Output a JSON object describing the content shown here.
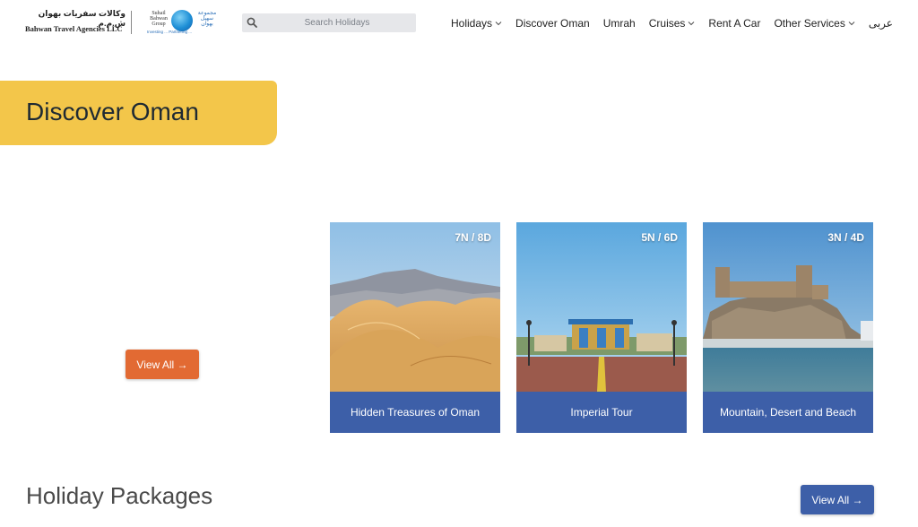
{
  "header": {
    "logo_arabic": "وكالات سفريات بهوان ش.م.م",
    "logo_english": "Bahwan Travel Agencies LLC",
    "group_logo_text_left": "Suhail Bahwan Group",
    "group_logo_text_right": "مجموعة سهيل بهوان",
    "group_logo_tagline": "Investing ... Partnering ...",
    "search_placeholder": "Search Holidays",
    "nav": [
      {
        "label": "Holidays",
        "dropdown": true
      },
      {
        "label": "Discover Oman",
        "dropdown": false
      },
      {
        "label": "Umrah",
        "dropdown": false
      },
      {
        "label": "Cruises",
        "dropdown": true
      },
      {
        "label": "Rent A Car",
        "dropdown": false
      },
      {
        "label": "Other Services",
        "dropdown": true
      },
      {
        "label": "عربى",
        "dropdown": false
      }
    ]
  },
  "banner": {
    "title": "Discover Oman",
    "color": "#f3c64a"
  },
  "discover": {
    "view_all_label": "View All →",
    "view_all_color": "#e26a33",
    "cards": [
      {
        "duration": "7N / 8D",
        "title": "Hidden Treasures of Oman",
        "image": "desert-dunes"
      },
      {
        "duration": "5N / 6D",
        "title": "Imperial Tour",
        "image": "royal-palace"
      },
      {
        "duration": "3N / 4D",
        "title": "Mountain, Desert and Beach",
        "image": "hilltop-fort"
      }
    ],
    "caption_color": "#3d5fa8"
  },
  "packages": {
    "title": "Holiday Packages",
    "view_all_label": "View All →",
    "view_all_color": "#3d5fa8"
  }
}
